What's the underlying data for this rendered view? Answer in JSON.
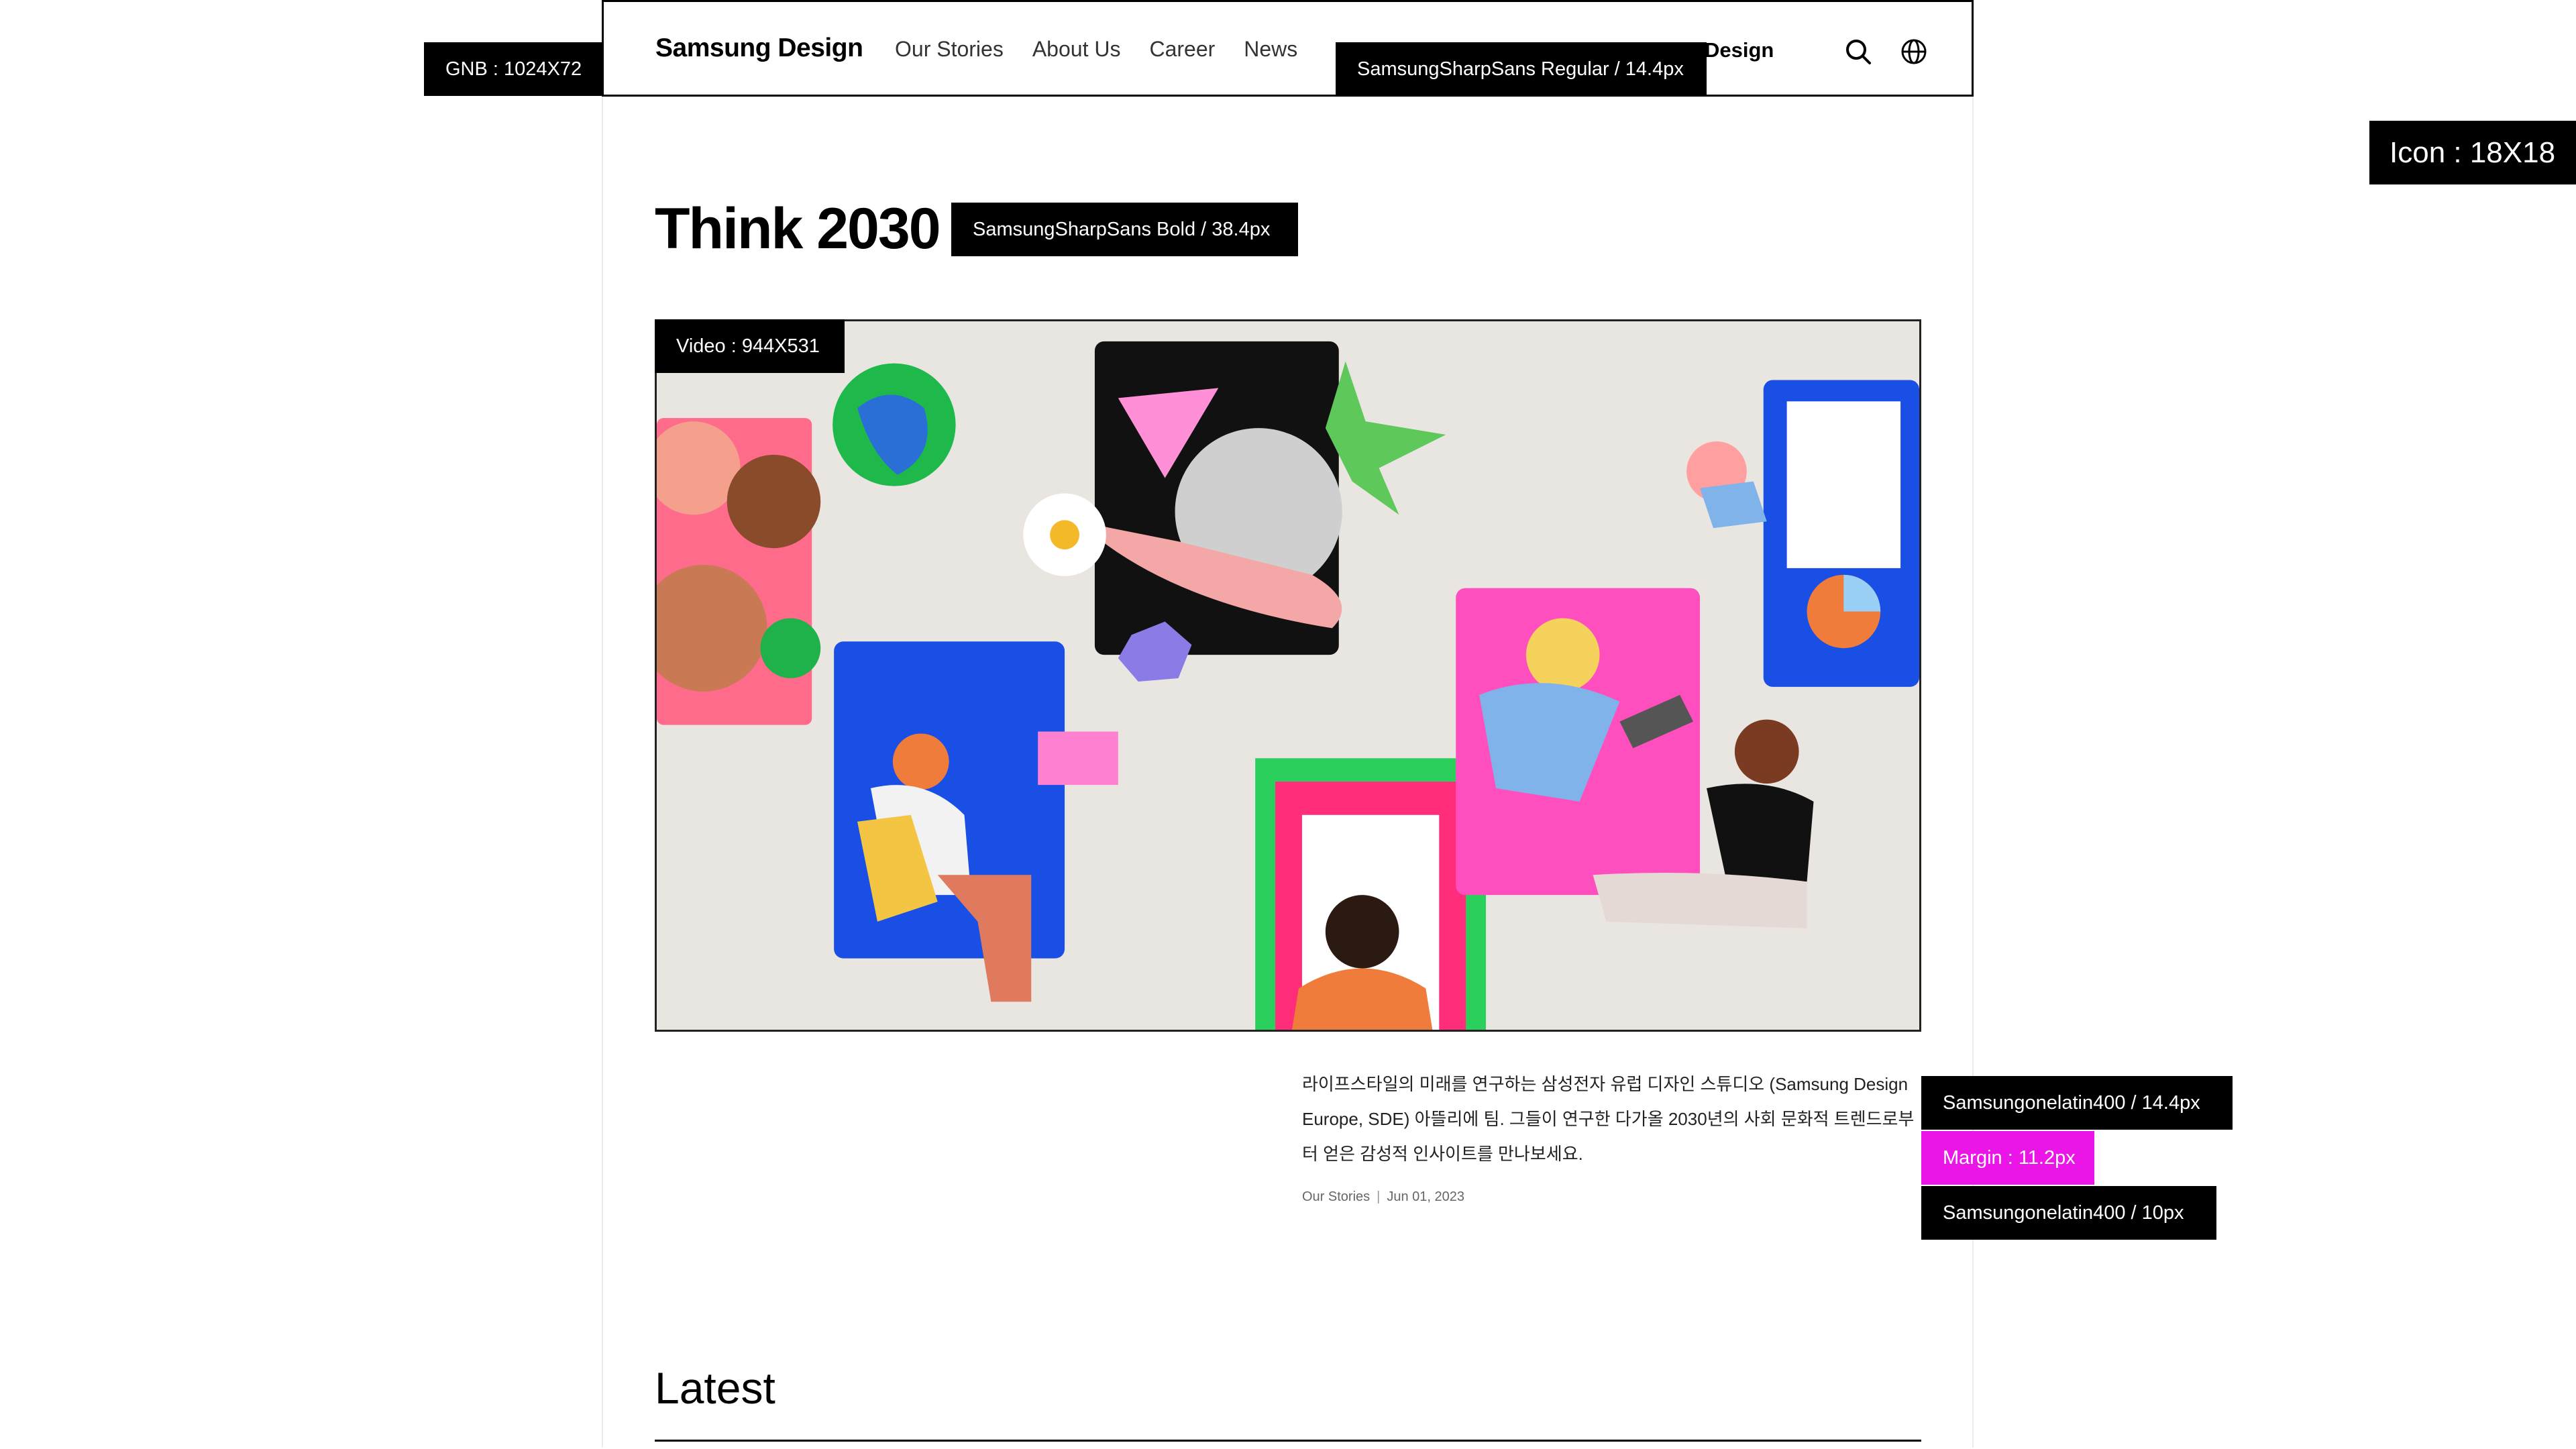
{
  "gnb": {
    "brand": "Samsung Design",
    "nav": [
      "Our Stories",
      "About Us",
      "Career",
      "News"
    ],
    "right_text": "Design",
    "icons": [
      "search-icon",
      "globe-icon"
    ]
  },
  "spec_tags": {
    "gnb": "GNB : 1024X72",
    "gnb_font": "SamsungSharpSans Regular / 14.4px",
    "icon": "Icon : 18X18",
    "headline_font": "SamsungSharpSans Bold / 38.4px",
    "video": "Video : 944X531",
    "desc_font": "Samsungonelatin400 / 14.4px",
    "margin": "Margin : 11.2px",
    "meta_font": "Samsungonelatin400 / 10px"
  },
  "hero": {
    "title": "Think 2030",
    "description": "라이프스타일의 미래를 연구하는 삼성전자 유럽 디자인 스튜디오 (Samsung Design Europe, SDE) 아뜰리에 팀. 그들이 연구한 다가올 2030년의 사회 문화적 트렌드로부터 얻은 감성적 인사이트를 만나보세요.",
    "category": "Our Stories",
    "separator": "|",
    "date": "Jun 01, 2023"
  },
  "latest": {
    "title": "Latest"
  },
  "colors": {
    "tag_bg": "#000000",
    "tag_highlight": "#ea15e6",
    "video_bg": "#e9e6e1"
  }
}
